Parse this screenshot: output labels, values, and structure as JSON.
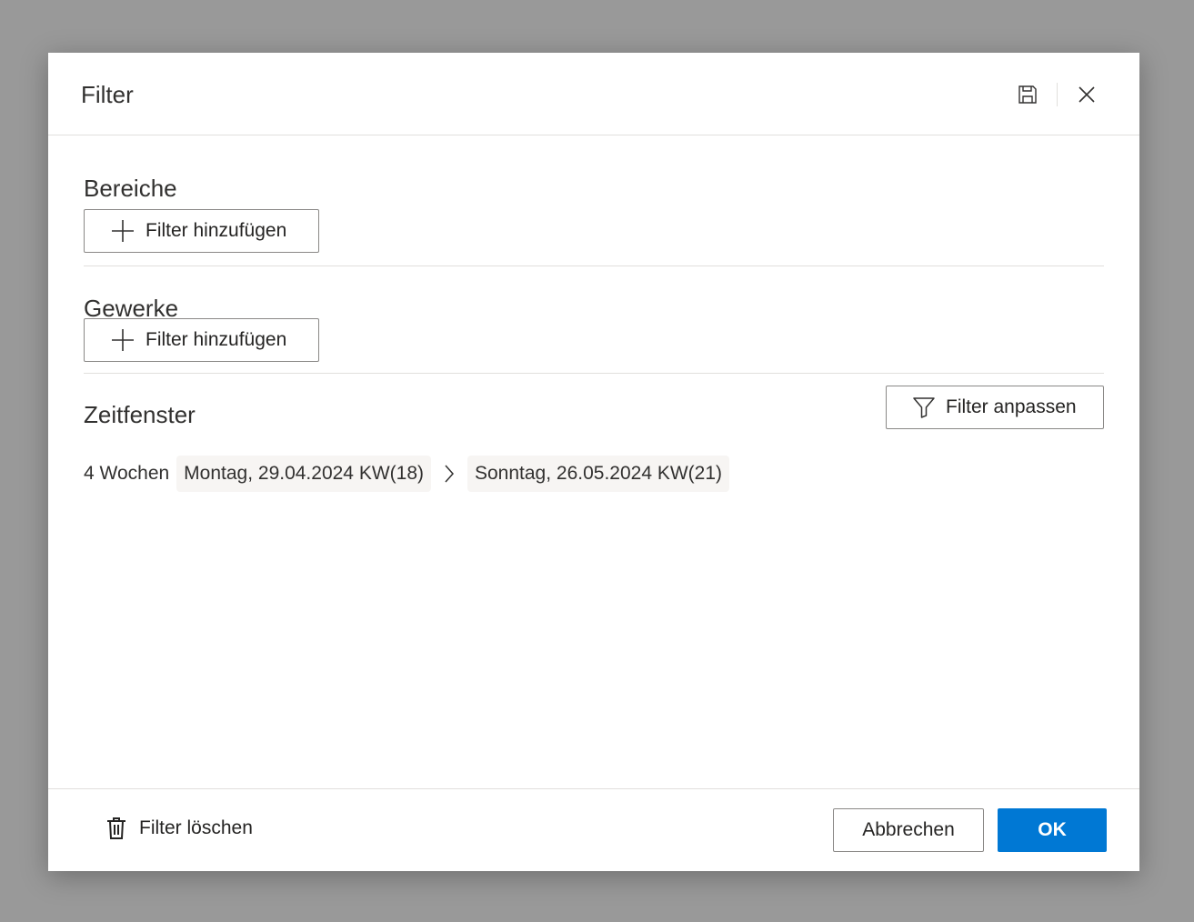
{
  "dialog": {
    "title": "Filter"
  },
  "sections": {
    "areas": {
      "title": "Bereiche",
      "add_label": "Filter hinzufügen"
    },
    "trades": {
      "title": "Gewerke",
      "add_label": "Filter hinzufügen"
    },
    "timeframe": {
      "title": "Zeitfenster",
      "adjust_label": "Filter anpassen",
      "duration": "4 Wochen",
      "start": "Montag, 29.04.2024 KW(18)",
      "end": "Sonntag, 26.05.2024 KW(21)"
    }
  },
  "footer": {
    "clear_label": "Filter löschen",
    "cancel_label": "Abbrechen",
    "ok_label": "OK"
  },
  "colors": {
    "primary": "#0078d4",
    "overlay": "#999999",
    "border": "#8a8886"
  },
  "icons": [
    "save-icon",
    "close-icon",
    "plus-icon",
    "funnel-icon",
    "chevron-right-icon",
    "trash-icon"
  ]
}
